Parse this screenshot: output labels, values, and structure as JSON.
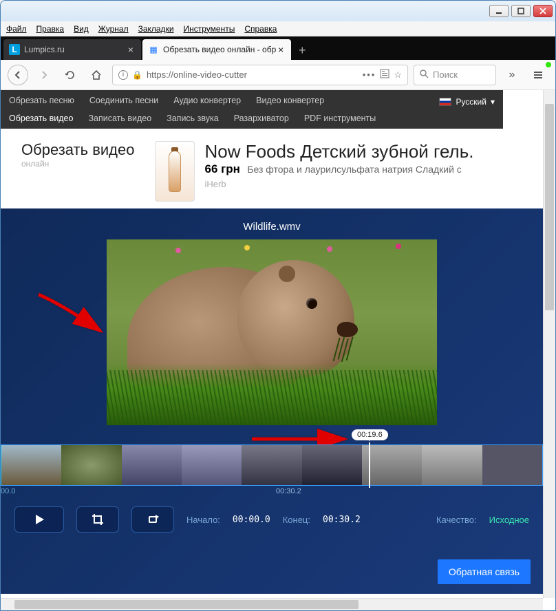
{
  "window": {
    "menus": [
      "Файл",
      "Правка",
      "Вид",
      "Журнал",
      "Закладки",
      "Инструменты",
      "Справка"
    ]
  },
  "tabs": {
    "items": [
      {
        "label": "Lumpics.ru",
        "icon": "L"
      },
      {
        "label": "Обрезать видео онлайн - обр",
        "icon": "film"
      }
    ]
  },
  "nav": {
    "url": "https://online-video-cutter",
    "search_placeholder": "Поиск"
  },
  "site_nav": {
    "row1": [
      "Обрезать песню",
      "Соединить песни",
      "Аудио конвертер",
      "Видео конвертер"
    ],
    "row2": [
      "Обрезать видео",
      "Записать видео",
      "Запись звука",
      "Разархиватор",
      "PDF инструменты"
    ],
    "lang": "Русский"
  },
  "header": {
    "title": "Обрезать видео",
    "subtitle": "онлайн"
  },
  "ad": {
    "title": "Now Foods Детский зубной гель.",
    "price": "66 грн",
    "desc": "Без фтора и лаурилсульфата натрия Сладкий с",
    "source": "iHerb"
  },
  "cutter": {
    "filename": "Wildlife.wmv",
    "bubble_time": "00:19.6",
    "timeline_start": "00.0",
    "timeline_mid": "00:30.2",
    "start_label": "Начало:",
    "start_value": "00:00.0",
    "end_label": "Конец:",
    "end_value": "00:30.2",
    "quality_label": "Качество:",
    "quality_value": "Исходное",
    "feedback": "Обратная связь"
  }
}
